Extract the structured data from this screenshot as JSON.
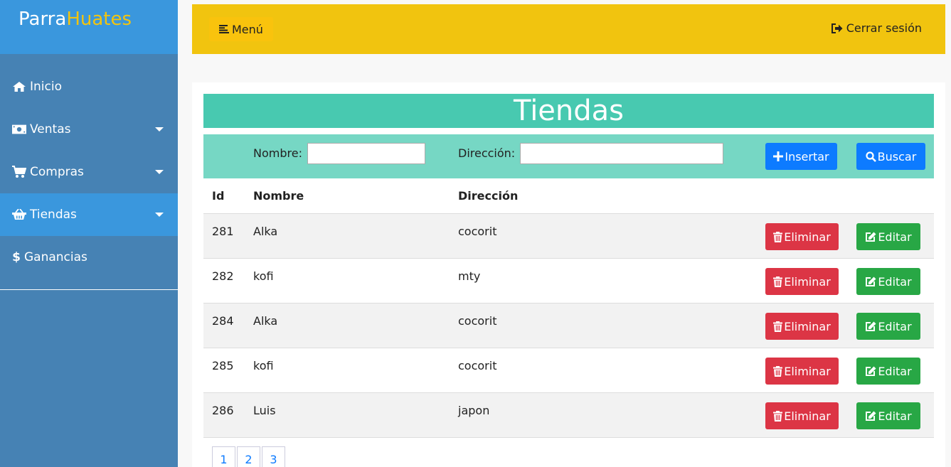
{
  "brand": {
    "part1": "Parra",
    "part2": "Huates"
  },
  "sidebar": {
    "items": [
      {
        "label": "Inicio",
        "icon": "home-icon"
      },
      {
        "label": "Ventas",
        "icon": "money-icon"
      },
      {
        "label": "Compras",
        "icon": "cart-icon"
      },
      {
        "label": "Tiendas",
        "icon": "basket-icon"
      },
      {
        "label": "Ganancias",
        "icon": "dollar-icon"
      }
    ]
  },
  "topbar": {
    "menu_label": "Menú",
    "logout_label": "Cerrar sesión"
  },
  "page": {
    "title": "Tiendas"
  },
  "filters": {
    "nombre_label": "Nombre:",
    "direccion_label": "Dirección:",
    "nombre_value": "",
    "direccion_value": "",
    "insert_label": "Insertar",
    "search_label": "Buscar"
  },
  "table": {
    "headers": [
      "Id",
      "Nombre",
      "Dirección"
    ],
    "delete_label": "Eliminar",
    "edit_label": "Editar",
    "rows": [
      {
        "id": "281",
        "nombre": "Alka",
        "direccion": "cocorit"
      },
      {
        "id": "282",
        "nombre": "kofi",
        "direccion": "mty"
      },
      {
        "id": "284",
        "nombre": "Alka",
        "direccion": "cocorit"
      },
      {
        "id": "285",
        "nombre": "kofi",
        "direccion": "cocorit"
      },
      {
        "id": "286",
        "nombre": "Luis",
        "direccion": "japon"
      }
    ]
  },
  "pagination": [
    "1",
    "2",
    "3"
  ],
  "colors": {
    "sidebar": "#4682b4",
    "sidebar_active": "#3a97dd",
    "topbar": "#f1c40f",
    "title_bar": "#48c9b0",
    "filter_bar": "#76d7c4",
    "primary": "#0d7bff",
    "danger": "#dc3545",
    "success": "#28a745"
  }
}
